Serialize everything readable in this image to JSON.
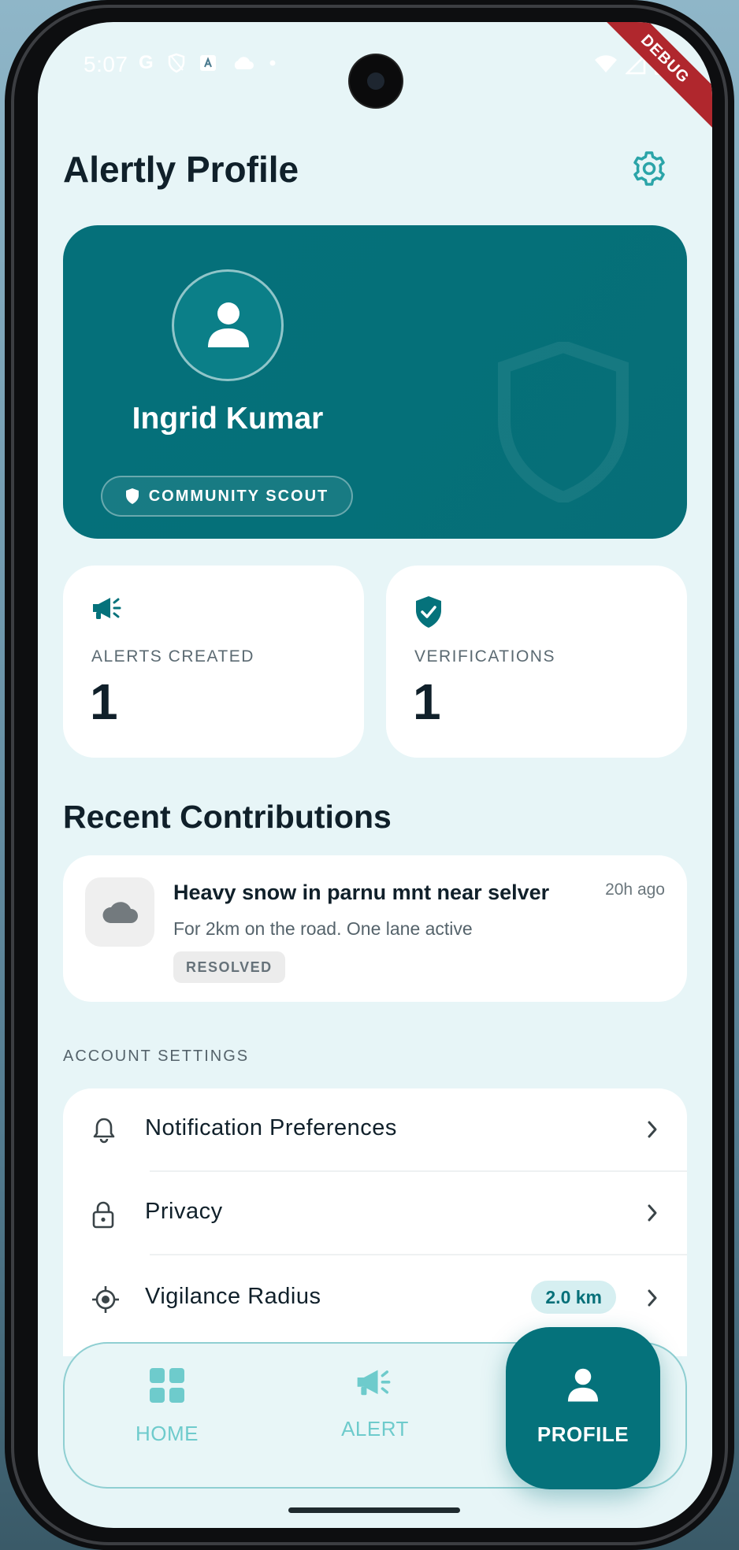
{
  "status_bar": {
    "time": "5:07",
    "debug_label": "DEBUG"
  },
  "header": {
    "title": "Alertly Profile"
  },
  "profile": {
    "name": "Ingrid Kumar",
    "badge": "COMMUNITY SCOUT"
  },
  "stats": [
    {
      "label": "ALERTS CREATED",
      "value": "1",
      "icon": "megaphone-icon"
    },
    {
      "label": "VERIFICATIONS",
      "value": "1",
      "icon": "verified-shield-icon"
    }
  ],
  "recent": {
    "title": "Recent Contributions",
    "items": [
      {
        "title": "Heavy snow in parnu mnt near selver",
        "description": "For 2km on the road. One lane active",
        "time": "20h ago",
        "status": "RESOLVED",
        "icon": "cloud-icon"
      }
    ]
  },
  "account_settings": {
    "label": "ACCOUNT SETTINGS",
    "items": [
      {
        "label": "Notification Preferences",
        "icon": "bell-icon"
      },
      {
        "label": "Privacy",
        "icon": "lock-icon"
      },
      {
        "label": "Vigilance Radius",
        "icon": "target-icon",
        "value": "2.0 km"
      }
    ]
  },
  "nav": {
    "items": [
      {
        "label": "HOME",
        "icon": "grid-icon"
      },
      {
        "label": "ALERT",
        "icon": "megaphone-icon"
      },
      {
        "label": "PROFILE",
        "icon": "person-icon",
        "active": true
      }
    ]
  },
  "colors": {
    "primary": "#05727B",
    "accent_light": "#6ECBCC",
    "background": "#E7F5F7",
    "text_dark": "#10202A"
  }
}
